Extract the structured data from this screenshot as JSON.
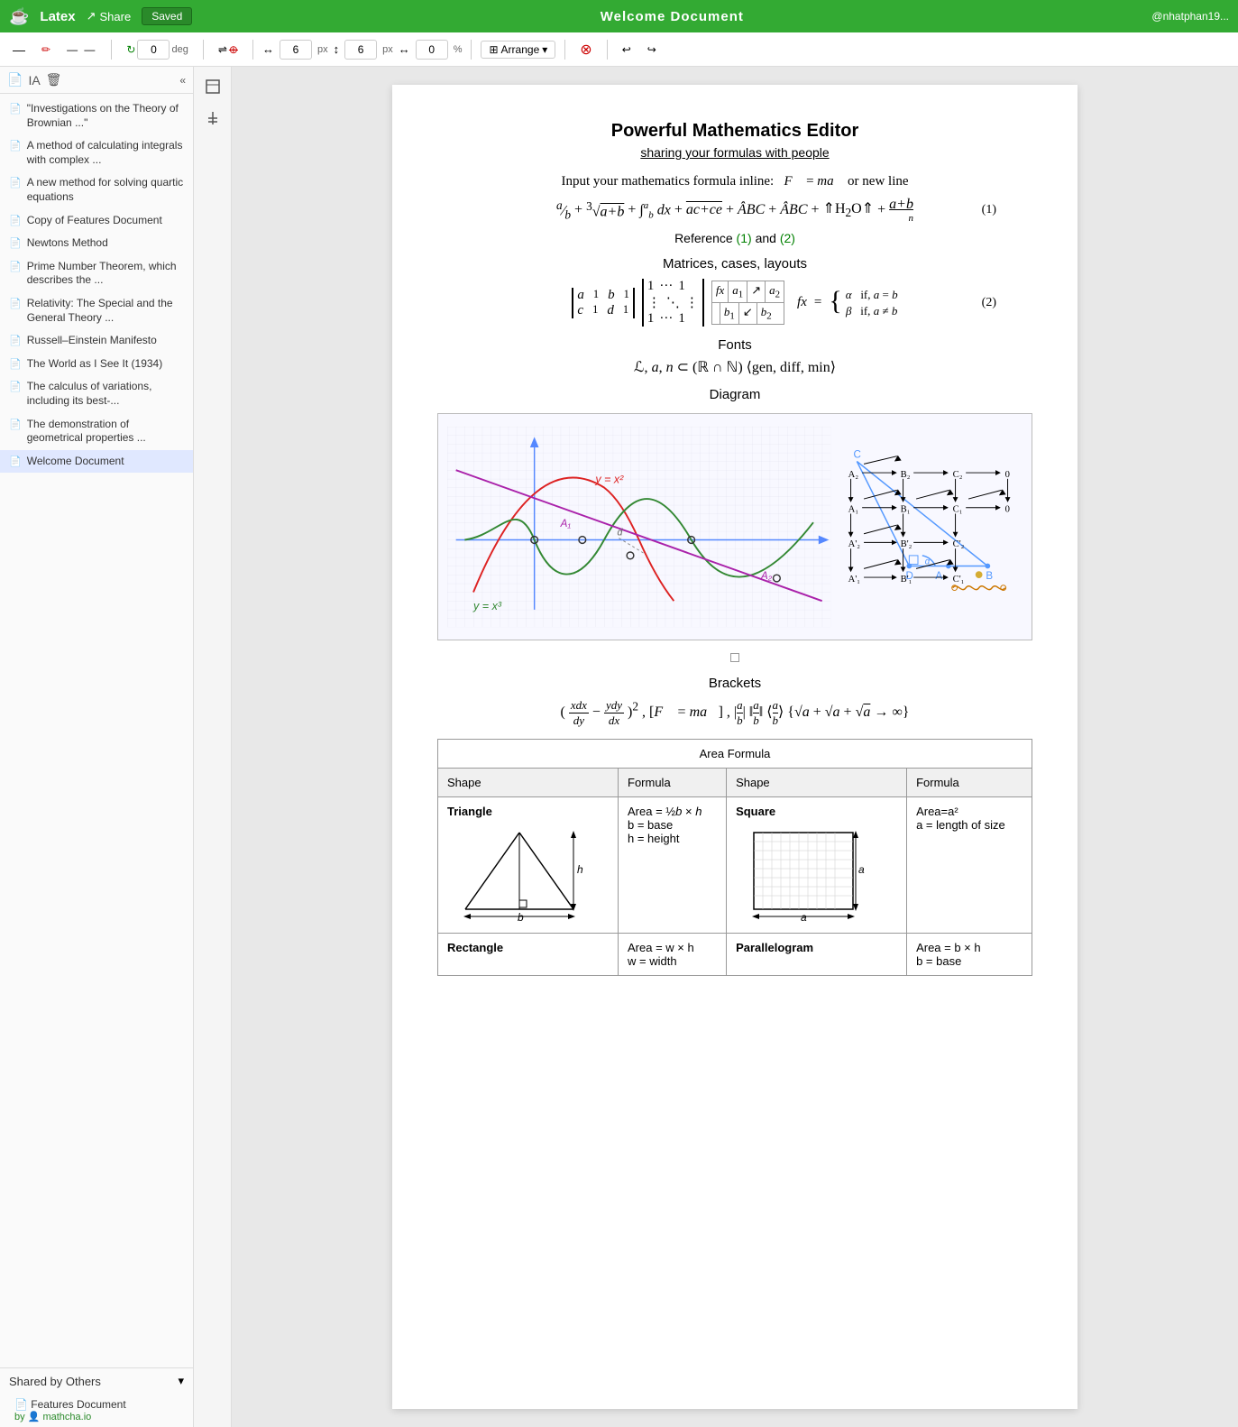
{
  "app": {
    "logo": "☕",
    "name": "Latex",
    "share_label": "Share",
    "saved_label": "Saved",
    "doc_title": "Welcome Document",
    "user": "@nhatphan19..."
  },
  "toolbar": {
    "rotation_value": "0",
    "rotation_unit": "deg",
    "width_value": "6",
    "height_value": "6",
    "opacity_value": "0",
    "opacity_unit": "%",
    "arrange_label": "Arrange"
  },
  "sidebar": {
    "collapse_icon": "«",
    "documents": [
      {
        "label": "\"Investigations on the Theory of Brownian ...\""
      },
      {
        "label": "A method of calculating integrals with complex ..."
      },
      {
        "label": "A new method for solving quartic equations"
      },
      {
        "label": "Copy of Features Document"
      },
      {
        "label": "Newtons Method"
      },
      {
        "label": "Prime Number Theorem, which describes the ..."
      },
      {
        "label": "Relativity: The Special and the General Theory ..."
      },
      {
        "label": "Russell–Einstein Manifesto"
      },
      {
        "label": "The World as I See It (1934)"
      },
      {
        "label": "The calculus of variations, including its best-..."
      },
      {
        "label": "The demonstration of geometrical properties ..."
      },
      {
        "label": "Welcome Document"
      }
    ],
    "shared_label": "Shared by Others",
    "shared_docs": [
      {
        "name": "Features Document",
        "by": "by",
        "author": "mathcha.io"
      }
    ]
  },
  "document": {
    "title": "Powerful Mathematics Editor",
    "subtitle": "sharing your formulas with people",
    "inline_text": "Input your mathematics formula inline:",
    "section_matrices": "Matrices, cases, layouts",
    "section_fonts": "Fonts",
    "section_diagram": "Diagram",
    "section_brackets": "Brackets",
    "area_table_title": "Area Formula",
    "ref_text": "Reference",
    "ref1": "(1)",
    "ref2": "and",
    "ref3": "(2)",
    "eq1_num": "(1)",
    "eq2_num": "(2)",
    "triangle_label": "Triangle",
    "triangle_formula": "Area = ½b × h",
    "triangle_b": "b = base",
    "triangle_h": "h = height",
    "square_label": "Square",
    "square_formula1": "Area=a²",
    "square_formula2": "a = length of size",
    "rectangle_label": "Rectangle",
    "rectangle_formula": "Area = w × h",
    "rectangle_sub": "w = width",
    "parallelogram_label": "Parallelogram",
    "parallelogram_formula": "Area = b × h",
    "parallelogram_sub": "b = base",
    "col_shape": "Shape",
    "col_formula": "Formula"
  }
}
